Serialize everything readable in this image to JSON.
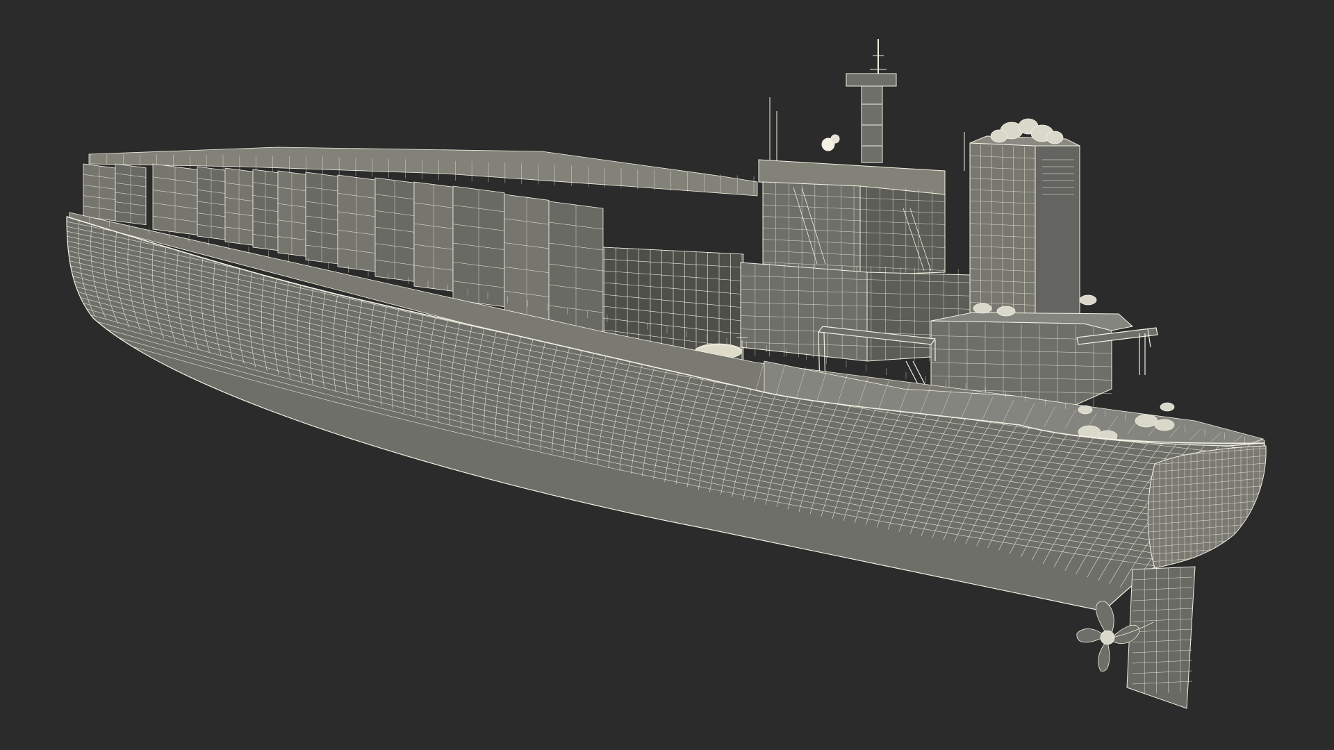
{
  "scene": {
    "subject": "wireframe-container-ship",
    "background_color": "#2b2b2b",
    "surface_color": "#6f6f6a",
    "surface_light_color": "#828279",
    "surface_dark_color": "#55554f",
    "wire_color": "#f2f1e3",
    "shadow_color": "#3d3d3a",
    "parts": [
      "hull",
      "container-stacks",
      "bridge-superstructure",
      "radar-mast",
      "funnel",
      "deck-cranes",
      "lifeboat",
      "rudder",
      "propeller"
    ]
  }
}
